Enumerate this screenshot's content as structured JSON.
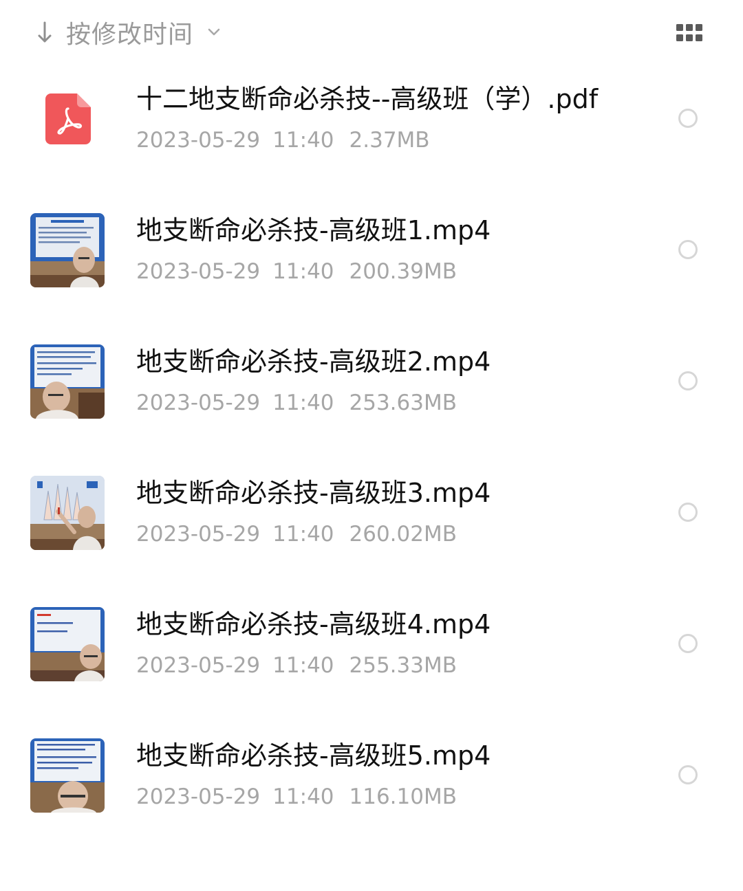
{
  "toolbar": {
    "sort_label": "按修改时间",
    "sort_icon": "arrow-down-icon",
    "chevron_icon": "chevron-down-icon",
    "view_icon": "grid-view-icon"
  },
  "files": [
    {
      "name": "十二地支断命必杀技--高级班（学）.pdf",
      "date": "2023-05-29",
      "time": "11:40",
      "size": "2.37MB",
      "type": "pdf",
      "icon": "pdf-icon"
    },
    {
      "name": "地支断命必杀技-高级班1.mp4",
      "date": "2023-05-29",
      "time": "11:40",
      "size": "200.39MB",
      "type": "video",
      "icon": "video-thumbnail"
    },
    {
      "name": "地支断命必杀技-高级班2.mp4",
      "date": "2023-05-29",
      "time": "11:40",
      "size": "253.63MB",
      "type": "video",
      "icon": "video-thumbnail"
    },
    {
      "name": "地支断命必杀技-高级班3.mp4",
      "date": "2023-05-29",
      "time": "11:40",
      "size": "260.02MB",
      "type": "video",
      "icon": "video-thumbnail"
    },
    {
      "name": "地支断命必杀技-高级班4.mp4",
      "date": "2023-05-29",
      "time": "11:40",
      "size": "255.33MB",
      "type": "video",
      "icon": "video-thumbnail"
    },
    {
      "name": "地支断命必杀技-高级班5.mp4",
      "date": "2023-05-29",
      "time": "11:40",
      "size": "116.10MB",
      "type": "video",
      "icon": "video-thumbnail"
    }
  ],
  "colors": {
    "pdf_red": "#f0575a",
    "meta_gray": "#a6a6a6",
    "circle_gray": "#d6d6d6"
  }
}
